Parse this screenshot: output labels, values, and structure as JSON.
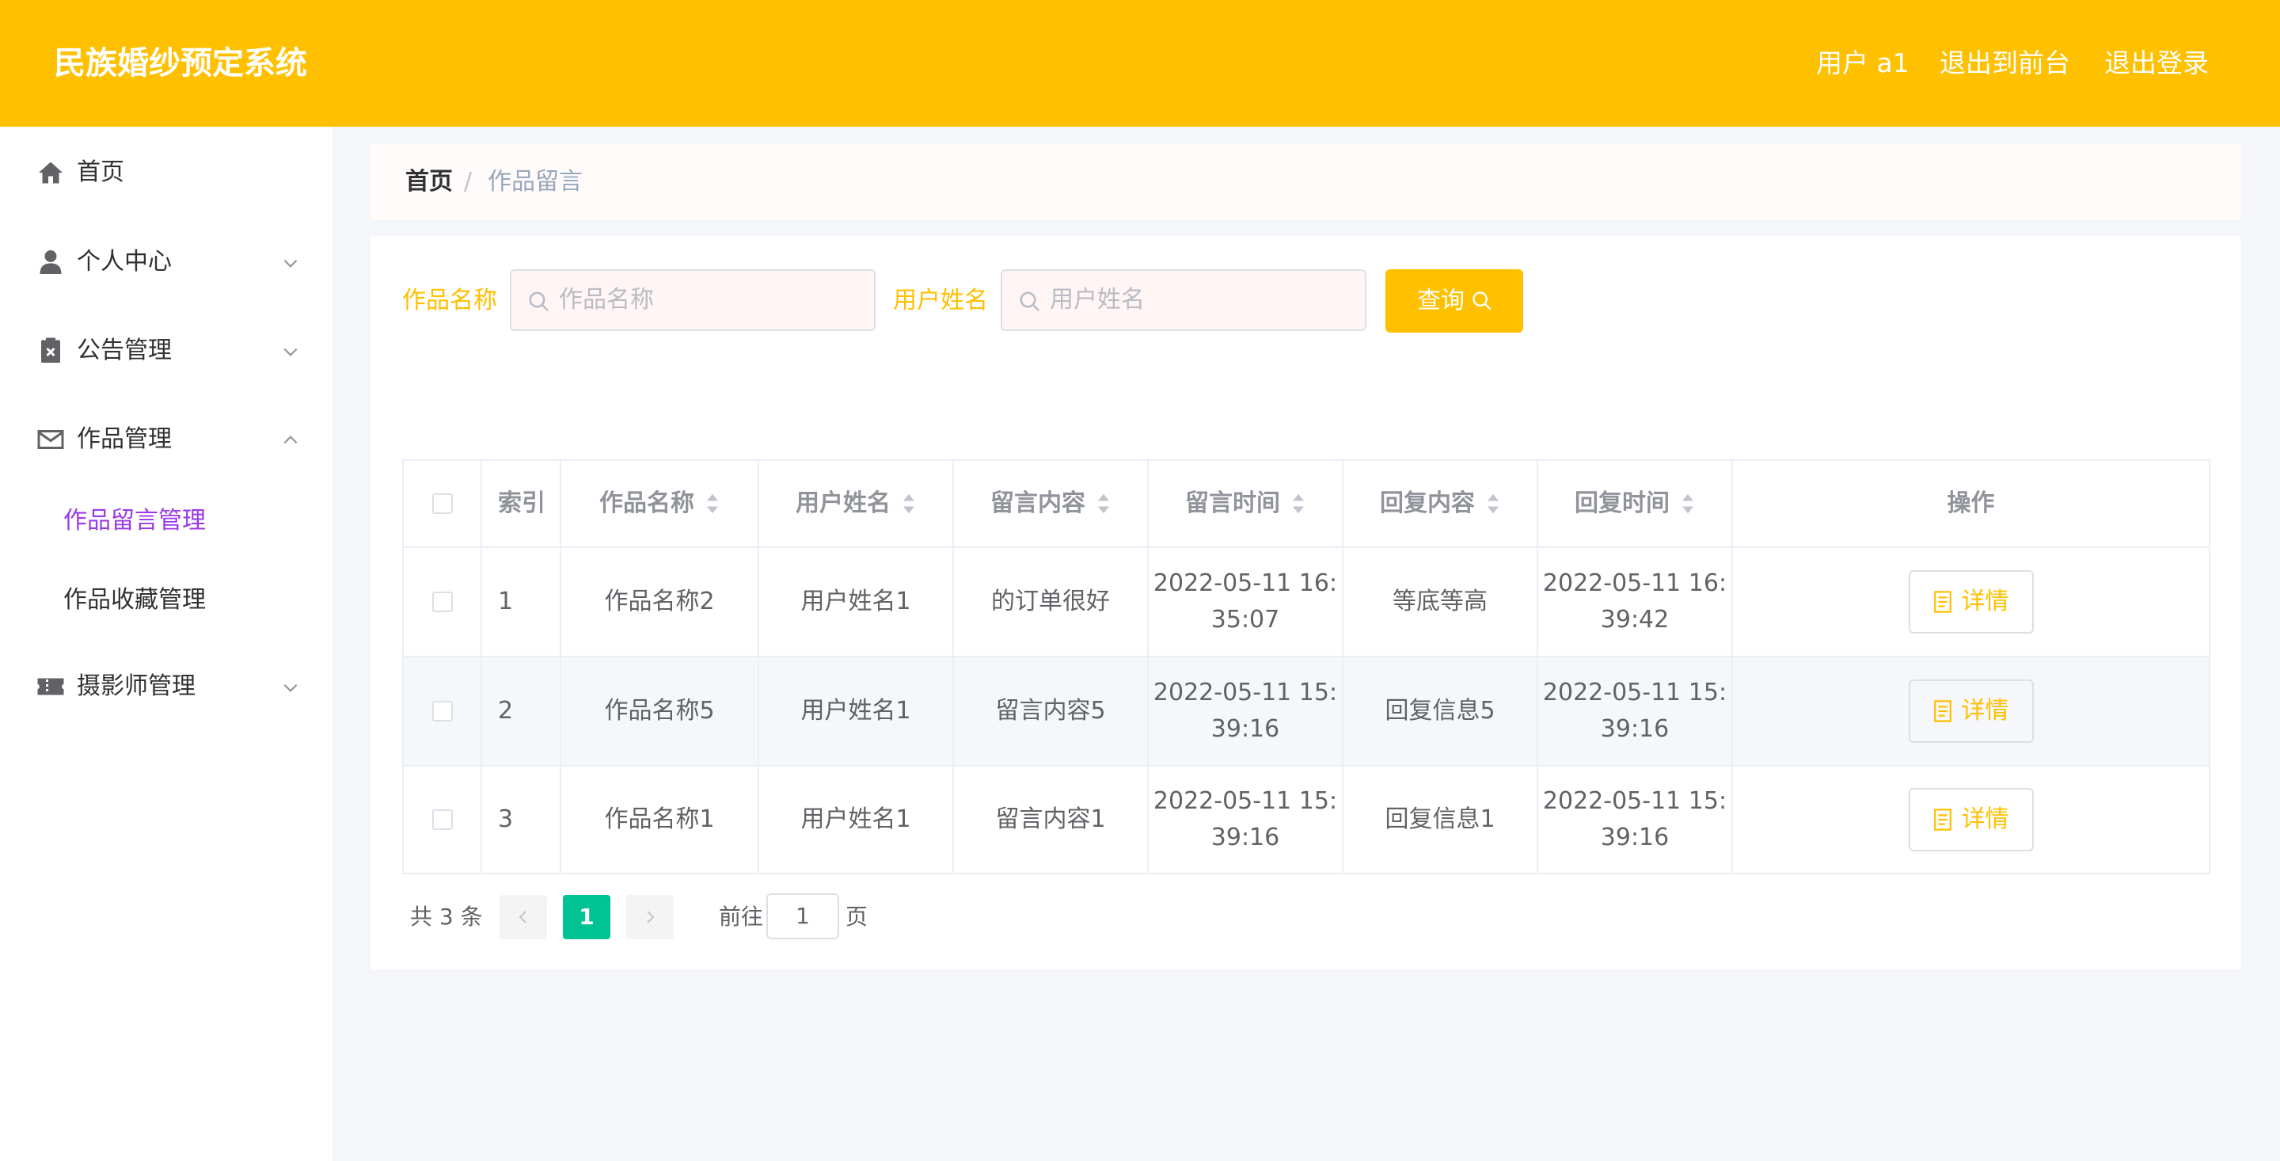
{
  "app": {
    "title": "民族婚纱预定系统",
    "user_label": "用户 a1",
    "to_front_label": "退出到前台",
    "logout_label": "退出登录"
  },
  "colors": {
    "brand": "#ffc000",
    "active_menu": "#9b38e6",
    "pager_active": "#00c292"
  },
  "sidebar": {
    "items": [
      {
        "label": "首页",
        "icon": "home-icon"
      },
      {
        "label": "个人中心",
        "icon": "user-icon"
      },
      {
        "label": "公告管理",
        "icon": "clipboard-icon"
      },
      {
        "label": "作品管理",
        "icon": "mail-icon"
      },
      {
        "label": "摄影师管理",
        "icon": "ticket-icon"
      }
    ],
    "subitems": [
      {
        "label": "作品留言管理",
        "active": true
      },
      {
        "label": "作品收藏管理",
        "active": false
      }
    ]
  },
  "breadcrumb": {
    "home": "首页",
    "separator": "/",
    "current": "作品留言"
  },
  "search": {
    "work_name_label": "作品名称",
    "work_name_placeholder": "作品名称",
    "user_name_label": "用户姓名",
    "user_name_placeholder": "用户姓名",
    "button_label": "查询"
  },
  "table": {
    "headers": [
      "索引",
      "作品名称",
      "用户姓名",
      "留言内容",
      "留言时间",
      "回复内容",
      "回复时间",
      "操作"
    ],
    "rows": [
      {
        "index": "1",
        "work_name": "作品名称2",
        "user_name": "用户姓名1",
        "content": "的订单很好",
        "msg_time": "2022-05-11 16:35:07",
        "msg_time_l1": "2022-05-11 16:",
        "msg_time_l2": "35:07",
        "reply": "等底等高",
        "reply_time": "2022-05-11 16:39:42",
        "reply_time_l1": "2022-05-11 16:",
        "reply_time_l2": "39:42"
      },
      {
        "index": "2",
        "work_name": "作品名称5",
        "user_name": "用户姓名1",
        "content": "留言内容5",
        "msg_time": "2022-05-11 15:39:16",
        "msg_time_l1": "2022-05-11 15:",
        "msg_time_l2": "39:16",
        "reply": "回复信息5",
        "reply_time": "2022-05-11 15:39:16",
        "reply_time_l1": "2022-05-11 15:",
        "reply_time_l2": "39:16"
      },
      {
        "index": "3",
        "work_name": "作品名称1",
        "user_name": "用户姓名1",
        "content": "留言内容1",
        "msg_time": "2022-05-11 15:39:16",
        "msg_time_l1": "2022-05-11 15:",
        "msg_time_l2": "39:16",
        "reply": "回复信息1",
        "reply_time": "2022-05-11 15:39:16",
        "reply_time_l1": "2022-05-11 15:",
        "reply_time_l2": "39:16"
      }
    ],
    "detail_label": "详情"
  },
  "pager": {
    "total_label": "共 3 条",
    "current_page": "1",
    "goto_prefix": "前往",
    "goto_value": "1",
    "goto_suffix": "页"
  }
}
